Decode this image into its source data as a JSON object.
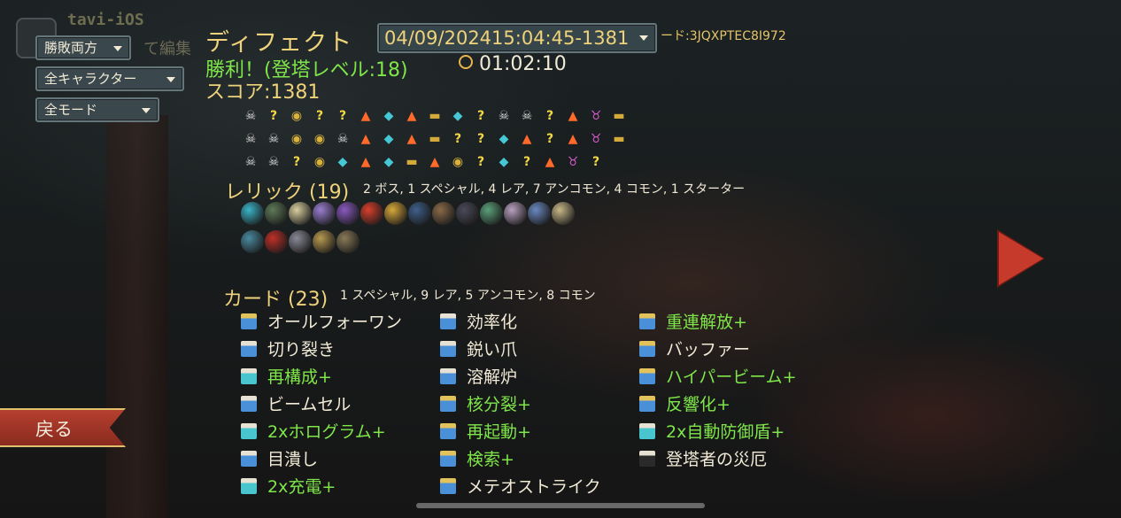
{
  "user": {
    "name": "tavi-iOS",
    "edit_label": "て編集"
  },
  "filters": {
    "result": "勝敗両方",
    "character": "全キャラクター",
    "mode": "全モード"
  },
  "run": {
    "title": "ディフェクト",
    "timestamp": "04/09/202415:04:45-1381",
    "seed": "ード:3JQXPTEC8I972",
    "victory": "勝利！(登塔レベル:18)",
    "play_time": "01:02:10",
    "score": "スコア:1381"
  },
  "path_rows": [
    [
      "monster",
      "unknown",
      "shop",
      "unknown",
      "unknown-monster",
      "elite",
      "rest",
      "elite",
      "treasure",
      "rest",
      "unknown",
      "monster",
      "monster",
      "unknown-monster",
      "elite",
      "boss",
      "treasure"
    ],
    [
      "monster",
      "monster",
      "shop",
      "shop",
      "monster",
      "elite",
      "rest",
      "elite",
      "treasure",
      "unknown",
      "unknown-monster",
      "rest",
      "elite",
      "unknown",
      "elite",
      "boss",
      "treasure"
    ],
    [
      "monster",
      "monster",
      "unknown",
      "shop",
      "rest",
      "elite",
      "rest",
      "treasure",
      "elite",
      "shop",
      "unknown",
      "rest",
      "unknown",
      "elite",
      "boss",
      "unknown"
    ]
  ],
  "relics": {
    "title": "レリック (19)",
    "summary": "2 ボス, 1 スペシャル, 4 レア, 7 アンコモン, 4 コモン, 1 スターター",
    "icon_colors": [
      "#3bb4c8",
      "#5e7a58",
      "#d9cfa0",
      "#9a7ed0",
      "#8a5ac0",
      "#d8402c",
      "#d8a83a",
      "#3f5f8a",
      "#8a6a48",
      "#4a4a5a",
      "#5aa07a",
      "#b8a0c0",
      "#6a88c0",
      "#c8b888",
      "#4a8aa0",
      "#c03028",
      "#8a8a98",
      "#b89a50",
      "#8a7a58"
    ]
  },
  "cards": {
    "title": "カード (23)",
    "summary": "1 スペシャル, 9 レア, 5 アンコモン, 8 コモン",
    "columns": [
      [
        {
          "name": "オールフォーワン",
          "up": false,
          "tone": "gold"
        },
        {
          "name": "切り裂き",
          "up": false,
          "tone": "plain"
        },
        {
          "name": "再構成+",
          "up": true,
          "tone": "teal"
        },
        {
          "name": "ビームセル",
          "up": false,
          "tone": "plain"
        },
        {
          "name": "2xホログラム+",
          "up": true,
          "tone": "teal"
        },
        {
          "name": "目潰し",
          "up": false,
          "tone": "plain"
        },
        {
          "name": "2x充電+",
          "up": true,
          "tone": "teal"
        }
      ],
      [
        {
          "name": "効率化",
          "up": false,
          "tone": "plain"
        },
        {
          "name": "鋭い爪",
          "up": false,
          "tone": "plain"
        },
        {
          "name": "溶解炉",
          "up": false,
          "tone": "plain"
        },
        {
          "name": "核分裂+",
          "up": true,
          "tone": "gold"
        },
        {
          "name": "再起動+",
          "up": true,
          "tone": "gold"
        },
        {
          "name": "検索+",
          "up": true,
          "tone": "gold"
        },
        {
          "name": "メテオストライク",
          "up": false,
          "tone": "gold"
        }
      ],
      [
        {
          "name": "重連解放+",
          "up": true,
          "tone": "gold"
        },
        {
          "name": "バッファー",
          "up": false,
          "tone": "gold"
        },
        {
          "name": "ハイパービーム+",
          "up": true,
          "tone": "gold"
        },
        {
          "name": "反響化+",
          "up": true,
          "tone": "gold"
        },
        {
          "name": "2x自動防御盾+",
          "up": true,
          "tone": "teal"
        },
        {
          "name": "登塔者の災厄",
          "up": false,
          "tone": "gray"
        }
      ]
    ]
  },
  "nav": {
    "back_label": "戻る"
  }
}
